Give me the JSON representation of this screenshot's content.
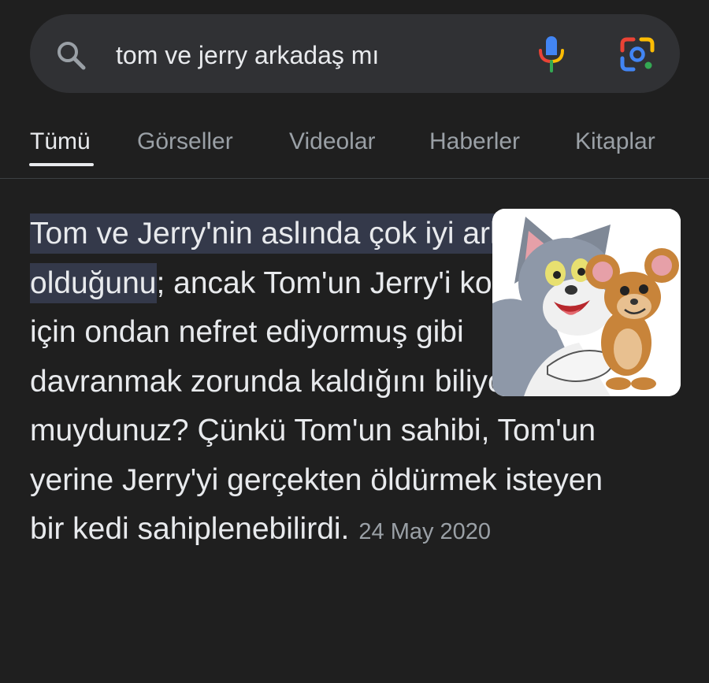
{
  "search": {
    "query": "tom ve jerry arkadaş mı",
    "icons": [
      "search-icon",
      "mic-icon",
      "lens-icon"
    ]
  },
  "tabs": [
    {
      "label": "Tümü",
      "active": true
    },
    {
      "label": "Görseller",
      "active": false
    },
    {
      "label": "Videolar",
      "active": false
    },
    {
      "label": "Haberler",
      "active": false
    },
    {
      "label": "Kitaplar",
      "active": false
    }
  ],
  "result": {
    "highlighted_text": "Tom ve Jerry'nin aslında çok iyi arkadaş olduğunu",
    "body_text": "; ancak Tom'un Jerry'i korumak için ondan nefret ediyormuş gibi davranmak zorunda kaldığını biliyor muydunuz? Çünkü Tom'un sahibi, Tom'un yerine Jerry'yi gerçekten öldürmek isteyen bir kedi sahiplenebilirdi.",
    "date": "24 May 2020",
    "thumbnail_icon": "tom-and-jerry-thumbnail"
  },
  "colors": {
    "background": "#1f1f1f",
    "search_bar": "#303134",
    "text": "#e8eaed",
    "muted_text": "#9aa0a6",
    "highlight": "#34394a"
  }
}
